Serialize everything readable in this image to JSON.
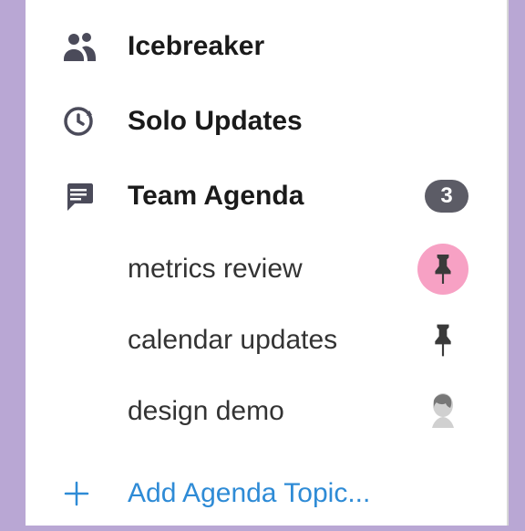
{
  "sections": {
    "icebreaker": {
      "label": "Icebreaker"
    },
    "solo": {
      "label": "Solo Updates"
    },
    "agenda": {
      "label": "Team Agenda",
      "count": "3",
      "items": [
        {
          "label": "metrics review"
        },
        {
          "label": "calendar updates"
        },
        {
          "label": "design demo"
        }
      ]
    }
  },
  "add": {
    "label": "Add Agenda Topic..."
  }
}
